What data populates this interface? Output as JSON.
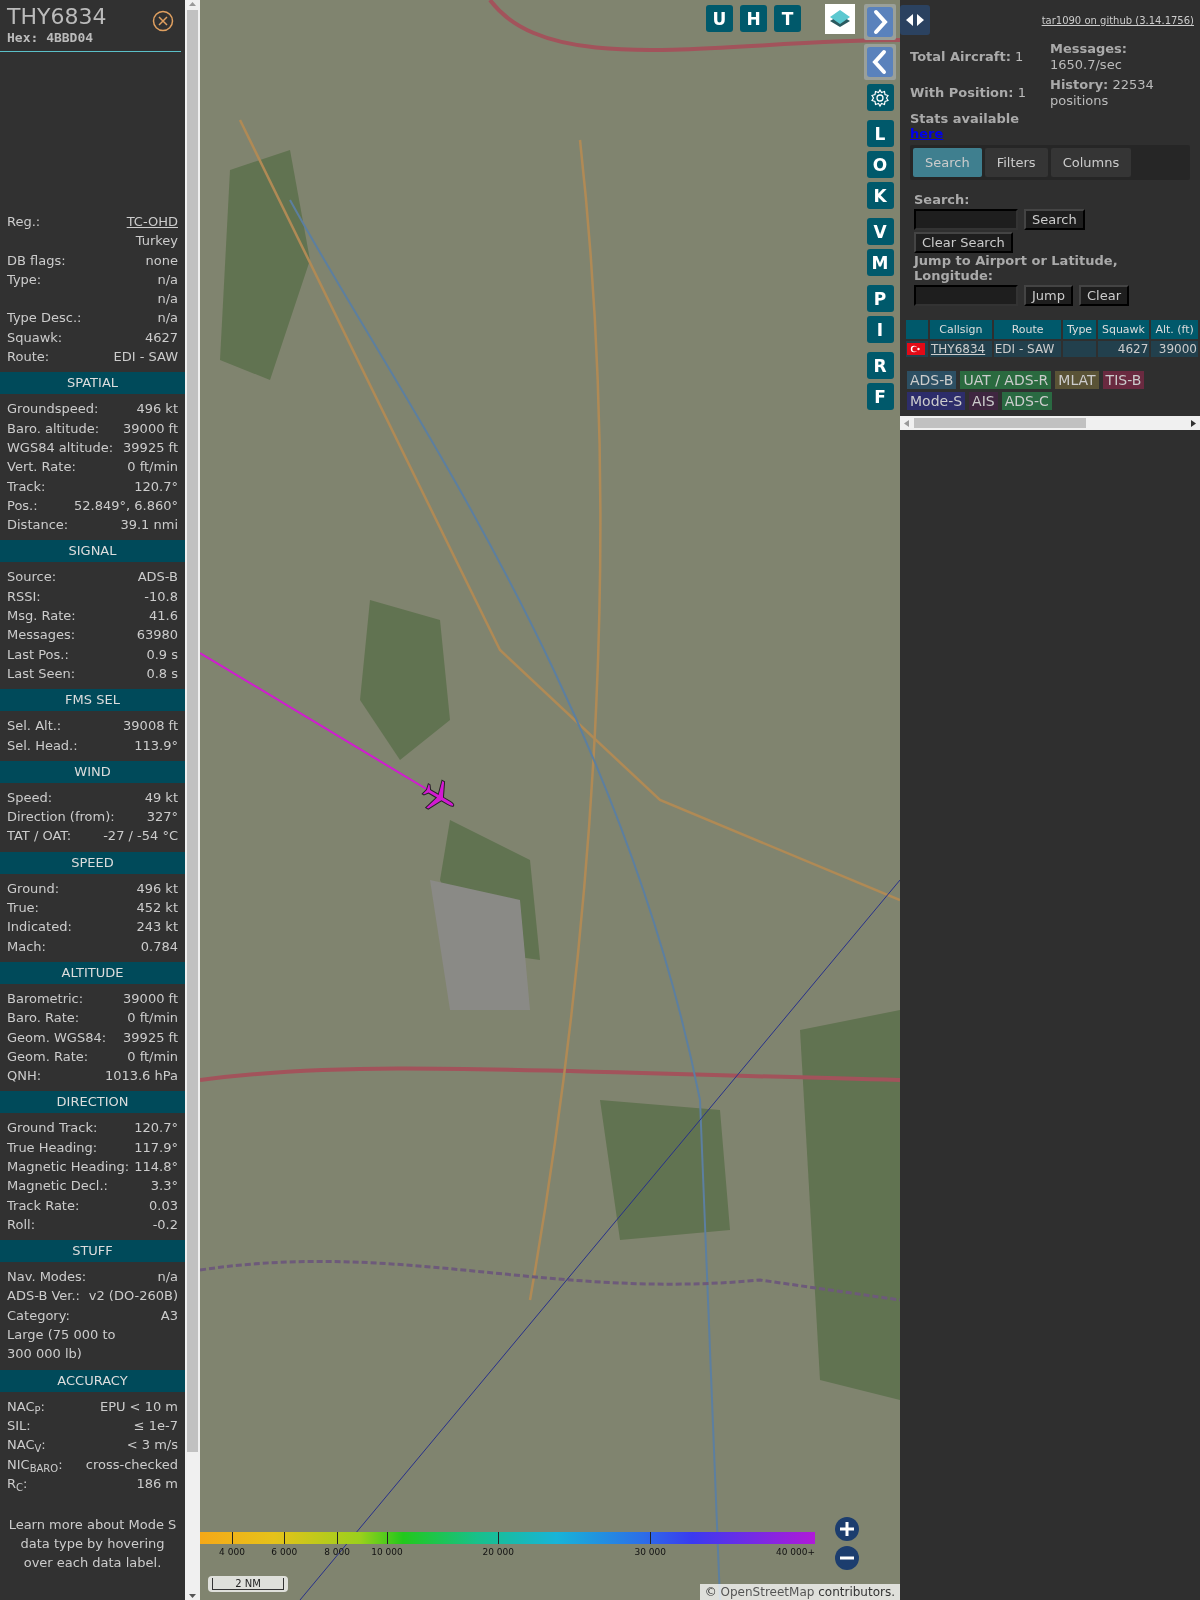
{
  "detail": {
    "callsign": "THY6834",
    "hex": "Hex: 4BBD04",
    "info": [
      {
        "kind": "link",
        "label": "Reg.:",
        "value": "TC-OHD"
      },
      {
        "kind": "text",
        "value": "Turkey"
      },
      {
        "kind": "text",
        "label": "DB flags:",
        "value": "none"
      },
      {
        "kind": "text",
        "label": "Type:",
        "value": "n/a"
      },
      {
        "kind": "text",
        "value": "n/a"
      },
      {
        "kind": "text",
        "label": "Type Desc.:",
        "value": "n/a"
      },
      {
        "kind": "text",
        "label": "Squawk:",
        "value": "4627"
      },
      {
        "kind": "text",
        "label": "Route:",
        "value": "EDI - SAW"
      }
    ],
    "sections": [
      {
        "title": "SPATIAL",
        "rows": [
          {
            "label": "Groundspeed:",
            "value": "496 kt"
          },
          {
            "label": "Baro. altitude:",
            "value": "39000 ft"
          },
          {
            "label": "WGS84 altitude:",
            "value": "39925 ft"
          },
          {
            "label": "Vert. Rate:",
            "value": "0 ft/min"
          },
          {
            "label": "Track:",
            "value": "120.7°"
          },
          {
            "label": "Pos.:",
            "value": "52.849°, 6.860°"
          },
          {
            "label": "Distance:",
            "value": "39.1 nmi"
          }
        ]
      },
      {
        "title": "SIGNAL",
        "rows": [
          {
            "label": "Source:",
            "value": "ADS-B"
          },
          {
            "label": "RSSI:",
            "value": "-10.8"
          },
          {
            "label": "Msg. Rate:",
            "value": "41.6"
          },
          {
            "label": "Messages:",
            "value": "63980"
          },
          {
            "label": "Last Pos.:",
            "value": "0.9 s"
          },
          {
            "label": "Last Seen:",
            "value": "0.8 s"
          }
        ]
      },
      {
        "title": "FMS SEL",
        "rows": [
          {
            "label": "Sel. Alt.:",
            "value": "39008 ft"
          },
          {
            "label": "Sel. Head.:",
            "value": "113.9°"
          }
        ]
      },
      {
        "title": "WIND",
        "rows": [
          {
            "label": "Speed:",
            "value": "49 kt"
          },
          {
            "label": "Direction (from):",
            "value": "327°"
          },
          {
            "label": "TAT / OAT:",
            "value": "-27 / -54 °C"
          }
        ]
      },
      {
        "title": "SPEED",
        "rows": [
          {
            "label": "Ground:",
            "value": "496 kt"
          },
          {
            "label": "True:",
            "value": "452 kt"
          },
          {
            "label": "Indicated:",
            "value": "243 kt"
          },
          {
            "label": "Mach:",
            "value": "0.784"
          }
        ]
      },
      {
        "title": "ALTITUDE",
        "rows": [
          {
            "label": "Barometric:",
            "value": "39000 ft"
          },
          {
            "label": "Baro. Rate:",
            "value": "0 ft/min"
          },
          {
            "label": "Geom. WGS84:",
            "value": "39925 ft"
          },
          {
            "label": "Geom. Rate:",
            "value": "0 ft/min"
          },
          {
            "label": "QNH:",
            "value": "1013.6 hPa"
          }
        ]
      },
      {
        "title": "DIRECTION",
        "rows": [
          {
            "label": "Ground Track:",
            "value": "120.7°"
          },
          {
            "label": "True Heading:",
            "value": "117.9°"
          },
          {
            "label": "Magnetic Heading:",
            "value": "114.8°"
          },
          {
            "label": "Magnetic Decl.:",
            "value": "3.3°"
          },
          {
            "label": "Track Rate:",
            "value": "0.03"
          },
          {
            "label": "Roll:",
            "value": "-0.2"
          }
        ]
      },
      {
        "title": "STUFF",
        "rows": [
          {
            "label": "Nav. Modes:",
            "value": "n/a"
          },
          {
            "label": "ADS-B Ver.:",
            "value": "v2 (DO-260B)"
          },
          {
            "label": "Category:",
            "value": "A3"
          },
          {
            "label": "Large (75 000 to 300 000 lb)"
          }
        ]
      },
      {
        "title": "ACCURACY",
        "rows": [
          {
            "label": "NAC$_{P}$:",
            "value": "EPU < 10 m"
          },
          {
            "label": "SIL:",
            "value": "≤ 1e-7"
          },
          {
            "label": "NAC$_{V}$:",
            "value": "< 3 m/s"
          },
          {
            "label": "NIC$_{BARO}$:",
            "value": "cross-checked"
          },
          {
            "label": "R$_{C}$:",
            "value": "186 m"
          }
        ]
      }
    ],
    "note": "Learn more about Mode S data type by hovering over each data label."
  },
  "map": {
    "top_buttons": [
      "U",
      "H",
      "T"
    ],
    "side_buttons": [
      [
        "L",
        "O",
        "K"
      ],
      [
        "V",
        "M"
      ],
      [
        "P",
        "I"
      ],
      [
        "R",
        "F"
      ]
    ],
    "legend_ticks": [
      "4 000",
      "6 000",
      "8 000",
      "10 000",
      "20 000",
      "30 000",
      "40 000+"
    ],
    "scale": "2 NM",
    "attribution": {
      "before": "©",
      "link": "OpenStreetMap",
      "after": "contributors."
    }
  },
  "side": {
    "version_link": "tar1090 on github (3.14.1756)",
    "stats": [
      {
        "label": "Total Aircraft:",
        "value": "1"
      },
      {
        "label": "With Position:",
        "value": "1"
      },
      {
        "label": "Messages:",
        "value": "1650.7/sec"
      },
      {
        "label": "History:",
        "value": "22534 positions"
      }
    ],
    "stats_link": {
      "label": "Stats available",
      "link": "here"
    },
    "tabs": [
      {
        "label": "Search",
        "selected": true
      },
      {
        "label": "Filters",
        "selected": false
      },
      {
        "label": "Columns",
        "selected": false
      }
    ],
    "search": {
      "label": "Search:",
      "button": "Search",
      "clear_button": "Clear Search"
    },
    "jump": {
      "label": "Jump to Airport or Latitude, Longitude:",
      "buttons": [
        "Jump",
        "Clear"
      ]
    },
    "table": {
      "columns": [
        "Callsign",
        "Route",
        "Type",
        "Squawk",
        "Alt. (ft)"
      ],
      "rows": [
        {
          "callsign": "THY6834",
          "route": "EDI - SAW",
          "squawk": "4627",
          "altitude": "39000"
        }
      ]
    },
    "legend": [
      {
        "label": "ADS-B",
        "color": "#2c4f63"
      },
      {
        "label": "UAT / ADS-R",
        "color": "#2a6a3f"
      },
      {
        "label": "MLAT",
        "color": "#5a5336"
      },
      {
        "label": "TIS-B",
        "color": "#6a2a40"
      },
      {
        "label": "Mode-S",
        "color": "#2d2d6a"
      },
      {
        "label": "AIS",
        "color": "#3f2640"
      },
      {
        "label": "ADS-C",
        "color": "#2a6a42"
      }
    ]
  }
}
